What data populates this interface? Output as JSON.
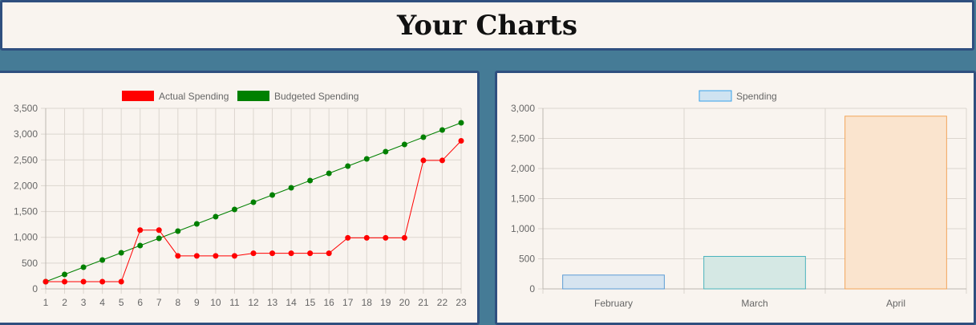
{
  "page": {
    "title": "Your Charts"
  },
  "chart_data": [
    {
      "type": "line",
      "x": [
        "1",
        "2",
        "3",
        "4",
        "5",
        "6",
        "7",
        "8",
        "9",
        "10",
        "11",
        "12",
        "13",
        "14",
        "15",
        "16",
        "17",
        "18",
        "19",
        "20",
        "21",
        "22",
        "23"
      ],
      "ylim": [
        0,
        3500
      ],
      "y_ticks": [
        0,
        500,
        1000,
        1500,
        2000,
        2500,
        3000,
        3500
      ],
      "grid": true,
      "legend_position": "top",
      "series": [
        {
          "name": "Actual Spending",
          "color": "#ff0000",
          "values": [
            140,
            140,
            140,
            140,
            140,
            1140,
            1140,
            640,
            640,
            640,
            640,
            690,
            690,
            690,
            690,
            690,
            990,
            990,
            990,
            990,
            2490,
            2490,
            2870
          ]
        },
        {
          "name": "Budgeted Spending",
          "color": "#008000",
          "values": [
            140,
            280,
            420,
            560,
            700,
            840,
            980,
            1120,
            1260,
            1400,
            1540,
            1680,
            1820,
            1960,
            2100,
            2240,
            2380,
            2520,
            2660,
            2800,
            2940,
            3080,
            3220
          ]
        }
      ]
    },
    {
      "type": "bar",
      "categories": [
        "February",
        "March",
        "April"
      ],
      "ylim": [
        0,
        3000
      ],
      "y_ticks": [
        0,
        500,
        1000,
        1500,
        2000,
        2500,
        3000
      ],
      "grid": true,
      "legend_position": "top",
      "series": [
        {
          "name": "Spending",
          "values": [
            230,
            540,
            2870
          ]
        }
      ],
      "bar_colors": [
        {
          "fill": "#d6e4f0",
          "stroke": "#5b9bd5"
        },
        {
          "fill": "#d5e8e4",
          "stroke": "#4bb3bd"
        },
        {
          "fill": "#fae4ce",
          "stroke": "#f2a65a"
        }
      ],
      "legend_color": {
        "fill": "#cfe3f1",
        "stroke": "#36a2eb"
      }
    }
  ]
}
